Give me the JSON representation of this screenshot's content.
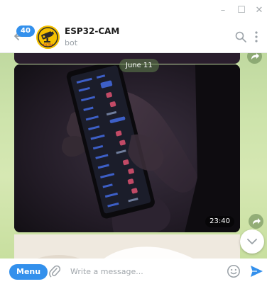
{
  "window": {
    "controls": {
      "minimize": "–",
      "maximize": "☐",
      "close": "✕"
    }
  },
  "header": {
    "unread_count": "40",
    "title": "ESP32-CAM",
    "subtitle": "bot",
    "avatar_text": "CCTV",
    "icons": {
      "back": "back-arrow-icon",
      "search": "search-icon",
      "more": "more-vertical-icon"
    }
  },
  "chat": {
    "date_label": "June 11",
    "photo_message": {
      "time": "23:40",
      "kind": "photo"
    },
    "icons": {
      "share": "share-icon",
      "scroll_down": "chevron-down-icon"
    }
  },
  "composer": {
    "menu_label": "Menu",
    "placeholder": "Write a message...",
    "value": "",
    "icons": {
      "attach": "paperclip-icon",
      "emoji": "emoji-icon",
      "send": "send-icon"
    }
  },
  "colors": {
    "accent": "#3390ec",
    "chat_background": "#cde3ab",
    "date_pill": "#62814f",
    "photo_background": "#17131a"
  }
}
